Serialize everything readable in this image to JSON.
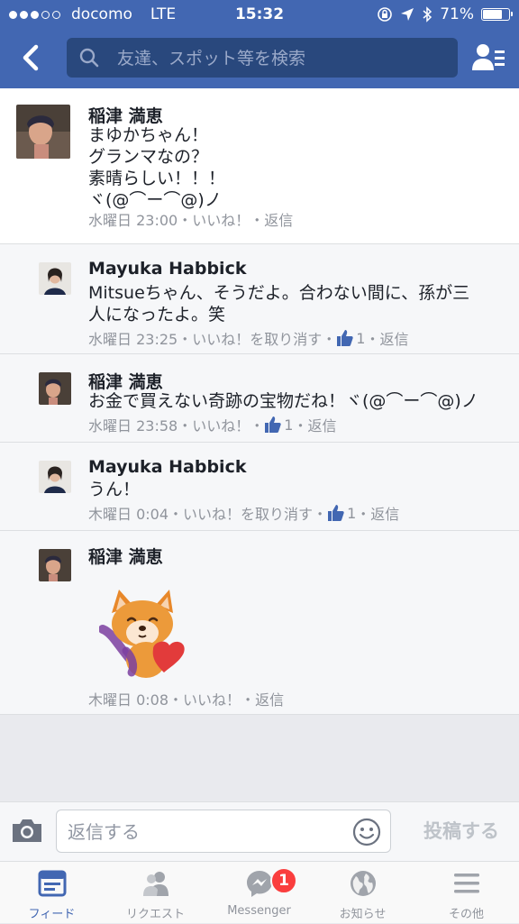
{
  "status_bar": {
    "carrier": "docomo",
    "network": "LTE",
    "time": "15:32",
    "battery": "71%"
  },
  "header": {
    "search_placeholder": "友達、スポット等を検索"
  },
  "comments": [
    {
      "name": "稲津 満恵",
      "text": "まゆかちゃん！\nグランマなの？\n素晴らしい！！！\nヾ(@⌒ー⌒@)ノ",
      "time": "水曜日 23:00",
      "like_action": "いいね！",
      "reply": "返信"
    },
    {
      "name": "Mayuka Habbick",
      "text": "Mitsueちゃん、そうだよ。合わない間に、孫が三\n人になったよ。笑",
      "time": "水曜日 23:25",
      "like_action": "いいね！を取り消す",
      "like_count": "1",
      "reply": "返信"
    },
    {
      "name": "稲津 満恵",
      "text": "お金で買えない奇跡の宝物だね！ヾ(@⌒ー⌒@)ノ",
      "time": "水曜日 23:58",
      "like_action": "いいね！",
      "like_count": "1",
      "reply": "返信"
    },
    {
      "name": "Mayuka Habbick",
      "text": "うん！",
      "time": "木曜日 0:04",
      "like_action": "いいね！を取り消す",
      "like_count": "1",
      "reply": "返信"
    },
    {
      "name": "稲津 満恵",
      "time": "木曜日 0:08",
      "like_action": "いいね！",
      "reply": "返信"
    }
  ],
  "separator": "・",
  "composer": {
    "placeholder": "返信する",
    "post_label": "投稿する"
  },
  "tabs": [
    {
      "label": "フィード",
      "icon": "feed-icon",
      "active": true
    },
    {
      "label": "リクエスト",
      "icon": "friend-requests-icon"
    },
    {
      "label": "Messenger",
      "icon": "messenger-icon",
      "badge": "1"
    },
    {
      "label": "お知らせ",
      "icon": "globe-icon"
    },
    {
      "label": "その他",
      "icon": "menu-icon"
    }
  ],
  "colors": {
    "brand": "#4267b2",
    "badge": "#fa3e3e",
    "meta_text": "#90949c"
  }
}
